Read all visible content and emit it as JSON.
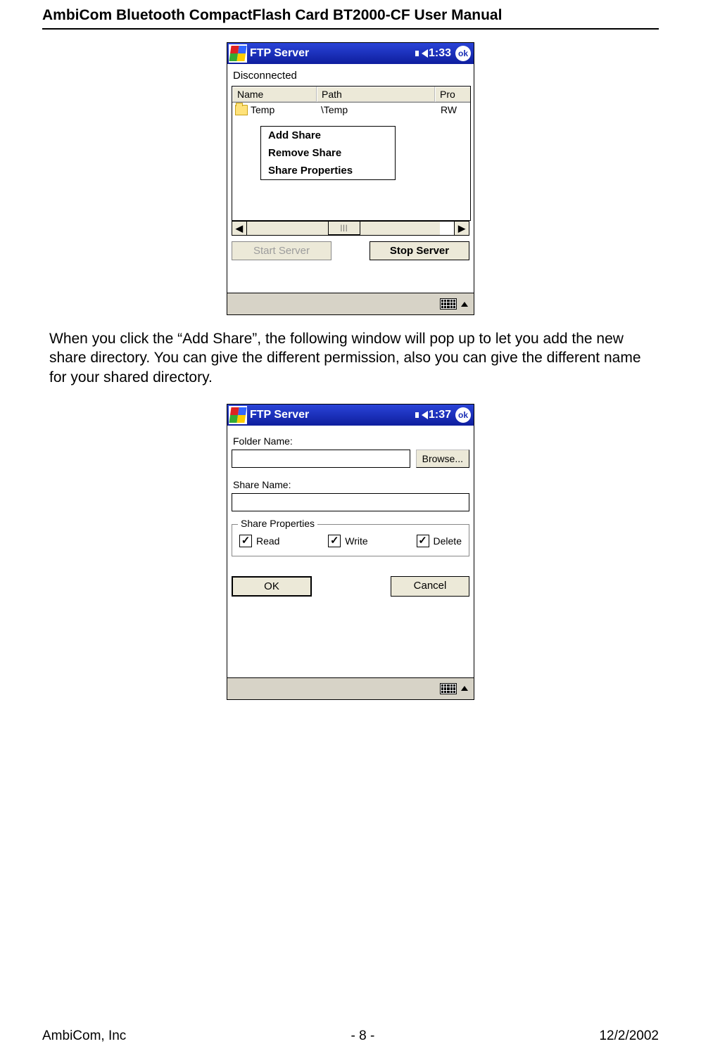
{
  "doc": {
    "header": "AmbiCom Bluetooth CompactFlash Card BT2000-CF User Manual",
    "footer_left": "AmbiCom, Inc",
    "footer_center": "- 8 -",
    "footer_right": "12/2/2002",
    "paragraph": "When you click the “Add Share”, the following window will pop up to let you add the new share directory. You can give the different permission, also you can give the different name for your shared directory."
  },
  "screenshot1": {
    "title": "FTP Server",
    "clock": "1:33",
    "ok": "ok",
    "status": "Disconnected",
    "columns": {
      "c1": "Name",
      "c2": "Path",
      "c3": "Pro"
    },
    "row": {
      "name": "Temp",
      "path": "\\Temp",
      "prop": "RW"
    },
    "context_menu": {
      "add": "Add Share",
      "remove": "Remove Share",
      "props": "Share Properties"
    },
    "scroll": {
      "left": "◀",
      "right": "▶",
      "thumb": "|||"
    },
    "buttons": {
      "start": "Start Server",
      "stop": "Stop Server"
    }
  },
  "screenshot2": {
    "title": "FTP Server",
    "clock": "1:37",
    "ok": "ok",
    "folder_label": "Folder Name:",
    "folder_value": "",
    "browse": "Browse...",
    "share_label": "Share Name:",
    "share_value": "",
    "props_legend": "Share Properties",
    "checks": {
      "read": "Read",
      "write": "Write",
      "delete": "Delete"
    },
    "ok_btn": "OK",
    "cancel_btn": "Cancel"
  }
}
